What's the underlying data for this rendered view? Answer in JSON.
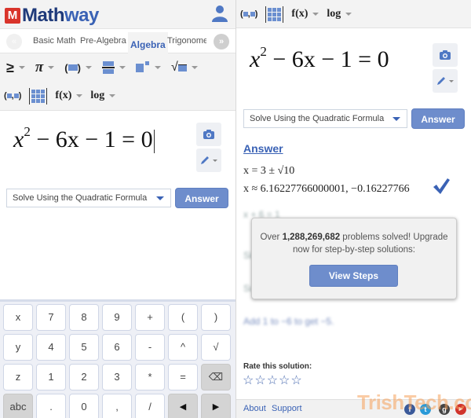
{
  "header": {
    "logo_mark": "M",
    "logo_text_a": "Math",
    "logo_text_b": "way"
  },
  "tabs": {
    "prev_icon": "«",
    "next_icon": "»",
    "items": [
      {
        "label": "Basic Math",
        "active": false
      },
      {
        "label": "Pre-Algebra",
        "active": false
      },
      {
        "label": "Algebra",
        "active": true
      },
      {
        "label": "Trigonomet",
        "active": false
      }
    ]
  },
  "toolbar": {
    "row1": [
      {
        "name": "inequality",
        "symbol": "≥"
      },
      {
        "name": "pi",
        "symbol": "π"
      },
      {
        "name": "absolute-value",
        "symbol": "(■)"
      },
      {
        "name": "fraction",
        "symbol": "frac"
      },
      {
        "name": "exponent",
        "symbol": "pow"
      },
      {
        "name": "sqrt",
        "symbol": "√"
      }
    ],
    "row2": [
      {
        "name": "point",
        "symbol": "(■,■)"
      },
      {
        "name": "matrix",
        "symbol": "matrix"
      },
      {
        "name": "function",
        "symbol": "f(x)"
      },
      {
        "name": "log",
        "symbol": "log"
      }
    ]
  },
  "equation": {
    "base": "x",
    "exp": "2",
    "rest": "− 6x − 1 = 0"
  },
  "solve_option": "Solve Using the Quadratic Formula",
  "answer_button": "Answer",
  "keypad": {
    "rows": [
      [
        "x",
        "7",
        "8",
        "9",
        "+",
        "(",
        ")"
      ],
      [
        "y",
        "4",
        "5",
        "6",
        "-",
        "^",
        "√"
      ],
      [
        "z",
        "1",
        "2",
        "3",
        "*",
        "=",
        "⌫"
      ],
      [
        "abc",
        ".",
        "0",
        ",",
        "/",
        "◀",
        "▶"
      ]
    ]
  },
  "result": {
    "heading": "Answer",
    "exact": "x = 3 ± √10",
    "approx": "x ≈ 6.16227766000001, −0.16227766",
    "blurred_lines": [
      "x + 6 = 1",
      "Simplify",
      "Subtract",
      "Add 1 to −6 to get −5."
    ]
  },
  "popup": {
    "text_before": "Over ",
    "count": "1,288,269,682",
    "text_after": " problems solved! Upgrade now for step-by-step solutions:",
    "button": "View Steps"
  },
  "rating": {
    "label": "Rate this solution:",
    "stars": 5,
    "selected": 0
  },
  "footer": {
    "about": "About",
    "support": "Support",
    "social": [
      "facebook",
      "twitter",
      "google-plus",
      "youtube"
    ]
  },
  "watermark": "TrishTech.com",
  "colors": {
    "brand_blue": "#3a62b5",
    "button_blue": "#6e8dcc",
    "logo_red": "#d9342b",
    "check_blue": "#3a62b5"
  }
}
